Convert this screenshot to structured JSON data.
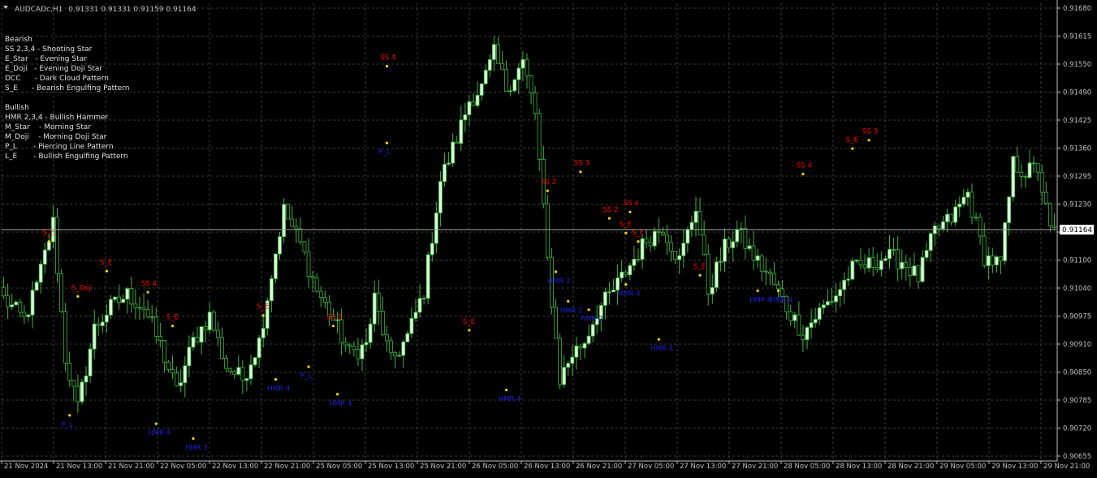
{
  "header": {
    "symbol_timeframe": "AUDCADc,H1",
    "ohlc": "0.91331 0.91331 0.91159 0.91164"
  },
  "legend": {
    "bearish_title": "Bearish",
    "bearish_items": [
      "SS 2,3,4 - Shooting Star",
      "E_Star   - Evening Star",
      "E_Doji   - Evening Doji Star",
      "DCC      - Dark Cloud Pattern",
      "S_E      - Bearish Engulfing Pattern"
    ],
    "bullish_title": "Bullish",
    "bullish_items": [
      "HMR 2,3,4 - Bullish Hammer",
      "M_Star    - Morning Star",
      "M_Doji    - Morning Doji Star",
      "P_L       - Piercing Line Pattern",
      "L_E       - Bullish Engulfing Pattern"
    ]
  },
  "colors": {
    "background": "#000000",
    "grid": "#3c3c3c",
    "axis": "#c0c0c0",
    "bull": "#d9ffd9",
    "bear": "#000000",
    "wick": "#3cb43c",
    "bear_label": "#ff0000",
    "bull_label": "#1e1edc",
    "arrow": "#ffd700",
    "price_line": "#a0a0a0"
  },
  "chart_data": {
    "type": "candlestick",
    "ylim": [
      0.9062,
      0.917
    ],
    "y_ticks": [
      "0.91680",
      "0.91615",
      "0.91550",
      "0.91490",
      "0.91425",
      "0.91360",
      "0.91295",
      "0.91230",
      "0.91165",
      "0.91100",
      "0.91040",
      "0.90975",
      "0.90910",
      "0.90850",
      "0.90785",
      "0.90720",
      "0.90655"
    ],
    "x_ticks": [
      "21 Nov 2024",
      "21 Nov 13:00",
      "21 Nov 21:00",
      "22 Nov 05:00",
      "22 Nov 13:00",
      "22 Nov 21:00",
      "25 Nov 05:00",
      "25 Nov 13:00",
      "25 Nov 21:00",
      "26 Nov 05:00",
      "26 Nov 13:00",
      "26 Nov 21:00",
      "27 Nov 05:00",
      "27 Nov 13:00",
      "27 Nov 21:00",
      "28 Nov 05:00",
      "28 Nov 13:00",
      "28 Nov 21:00",
      "29 Nov 05:00",
      "29 Nov 13:00",
      "29 Nov 21:00"
    ],
    "current_price": "0.91164",
    "anchors": [
      [
        0,
        0.91
      ],
      [
        5,
        0.9095
      ],
      [
        8,
        0.9103
      ],
      [
        12,
        0.9118
      ],
      [
        15,
        0.9086
      ],
      [
        18,
        0.9074
      ],
      [
        22,
        0.9093
      ],
      [
        26,
        0.9098
      ],
      [
        30,
        0.9101
      ],
      [
        34,
        0.9098
      ],
      [
        38,
        0.9089
      ],
      [
        42,
        0.9078
      ],
      [
        46,
        0.909
      ],
      [
        50,
        0.9096
      ],
      [
        54,
        0.9084
      ],
      [
        58,
        0.9081
      ],
      [
        62,
        0.909
      ],
      [
        66,
        0.9111
      ],
      [
        68,
        0.9121
      ],
      [
        72,
        0.9113
      ],
      [
        76,
        0.9102
      ],
      [
        80,
        0.9095
      ],
      [
        84,
        0.9087
      ],
      [
        88,
        0.9089
      ],
      [
        90,
        0.91
      ],
      [
        94,
        0.9085
      ],
      [
        98,
        0.9091
      ],
      [
        102,
        0.9102
      ],
      [
        106,
        0.9128
      ],
      [
        110,
        0.9138
      ],
      [
        113,
        0.9147
      ],
      [
        116,
        0.915
      ],
      [
        119,
        0.9158
      ],
      [
        122,
        0.915
      ],
      [
        126,
        0.9156
      ],
      [
        129,
        0.9144
      ],
      [
        132,
        0.9109
      ],
      [
        135,
        0.9081
      ],
      [
        138,
        0.9087
      ],
      [
        141,
        0.909
      ],
      [
        144,
        0.9097
      ],
      [
        148,
        0.9102
      ],
      [
        152,
        0.9108
      ],
      [
        156,
        0.9114
      ],
      [
        160,
        0.9117
      ],
      [
        164,
        0.9109
      ],
      [
        168,
        0.9122
      ],
      [
        171,
        0.9102
      ],
      [
        175,
        0.9112
      ],
      [
        178,
        0.9116
      ],
      [
        182,
        0.911
      ],
      [
        186,
        0.9105
      ],
      [
        190,
        0.9098
      ],
      [
        194,
        0.9092
      ],
      [
        198,
        0.9097
      ],
      [
        202,
        0.9101
      ],
      [
        206,
        0.9107
      ],
      [
        210,
        0.9108
      ],
      [
        214,
        0.911
      ],
      [
        218,
        0.9109
      ],
      [
        222,
        0.9105
      ],
      [
        226,
        0.9116
      ],
      [
        230,
        0.9119
      ],
      [
        234,
        0.9125
      ],
      [
        238,
        0.911
      ],
      [
        242,
        0.9108
      ],
      [
        245,
        0.9132
      ],
      [
        248,
        0.913
      ],
      [
        251,
        0.9131
      ],
      [
        254,
        0.9116
      ]
    ],
    "bear_signals": [
      {
        "label": "S_E",
        "bar": 11,
        "price": 0.91155
      },
      {
        "label": "S_Doji",
        "bar": 18,
        "price": 0.91025
      },
      {
        "label": "S_E",
        "bar": 25,
        "price": 0.91085
      },
      {
        "label": "SS 4",
        "bar": 35,
        "price": 0.91035
      },
      {
        "label": "S_E",
        "bar": 41,
        "price": 0.90955
      },
      {
        "label": "S_E",
        "bar": 63,
        "price": 0.9098
      },
      {
        "label": "SS 2",
        "bar": 80,
        "price": 0.90955
      },
      {
        "label": "SS 4",
        "bar": 93,
        "price": 0.9157
      },
      {
        "label": "S_E",
        "bar": 113,
        "price": 0.90945
      },
      {
        "label": "SS 2",
        "bar": 132,
        "price": 0.91275
      },
      {
        "label": "SS 3",
        "bar": 140,
        "price": 0.9132
      },
      {
        "label": "SS 2",
        "bar": 147,
        "price": 0.9121
      },
      {
        "label": "SS 4",
        "bar": 152,
        "price": 0.91225
      },
      {
        "label": "S_E",
        "bar": 151,
        "price": 0.91175
      },
      {
        "label": "S_E",
        "bar": 154,
        "price": 0.91155
      },
      {
        "label": "S_E",
        "bar": 169,
        "price": 0.91075
      },
      {
        "label": "SS 4",
        "bar": 194,
        "price": 0.91315
      },
      {
        "label": "S_E",
        "bar": 206,
        "price": 0.91375
      },
      {
        "label": "SS 3",
        "bar": 210,
        "price": 0.91395
      }
    ],
    "bull_signals": [
      {
        "label": "P_L",
        "bar": 16,
        "price": 0.90705
      },
      {
        "label": "HMR 4",
        "bar": 37,
        "price": 0.90685
      },
      {
        "label": "HMR 3",
        "bar": 46,
        "price": 0.9065
      },
      {
        "label": "HMR 4",
        "bar": 66,
        "price": 0.9079
      },
      {
        "label": "P_L",
        "bar": 74,
        "price": 0.9082
      },
      {
        "label": "HMR 4",
        "bar": 81,
        "price": 0.90755
      },
      {
        "label": "P_L",
        "bar": 93,
        "price": 0.9135
      },
      {
        "label": "HMR 4",
        "bar": 122,
        "price": 0.90765
      },
      {
        "label": "HMR 3",
        "bar": 134,
        "price": 0.91045
      },
      {
        "label": "HMR 2",
        "bar": 137,
        "price": 0.90975
      },
      {
        "label": "HMR 2",
        "bar": 142,
        "price": 0.90955
      },
      {
        "label": "HMR 4",
        "bar": 151,
        "price": 0.91015
      },
      {
        "label": "HMR 4",
        "bar": 159,
        "price": 0.90885
      },
      {
        "label": "HMP 4",
        "bar": 183,
        "price": 0.91
      },
      {
        "label": "HMR 4",
        "bar": 188,
        "price": 0.91
      }
    ]
  }
}
